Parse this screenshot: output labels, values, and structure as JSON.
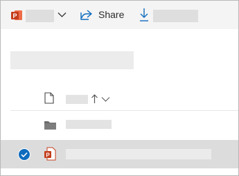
{
  "toolbar": {
    "app_icon": "powerpoint-icon",
    "app_icon_color": "#c43e1c",
    "chevron_icon": "chevron-down-icon",
    "share_icon": "share-icon",
    "share_label": "Share",
    "download_icon": "download-icon",
    "accent_color": "#0f6cbd"
  },
  "list": {
    "header": {
      "file_type_icon": "document-icon",
      "sort_icon": "arrow-up-icon",
      "sort_menu_icon": "chevron-down-icon"
    },
    "rows": [
      {
        "icon": "folder-icon",
        "selected": false
      },
      {
        "icon": "powerpoint-file-icon",
        "selected": true,
        "check_icon": "checkmark-circle-icon"
      }
    ]
  },
  "colors": {
    "toolbar_bg": "#f4f4f4",
    "selected_row_bg": "#dcdcdc",
    "check_color": "#0f6cbd",
    "redaction": "#dedede"
  }
}
